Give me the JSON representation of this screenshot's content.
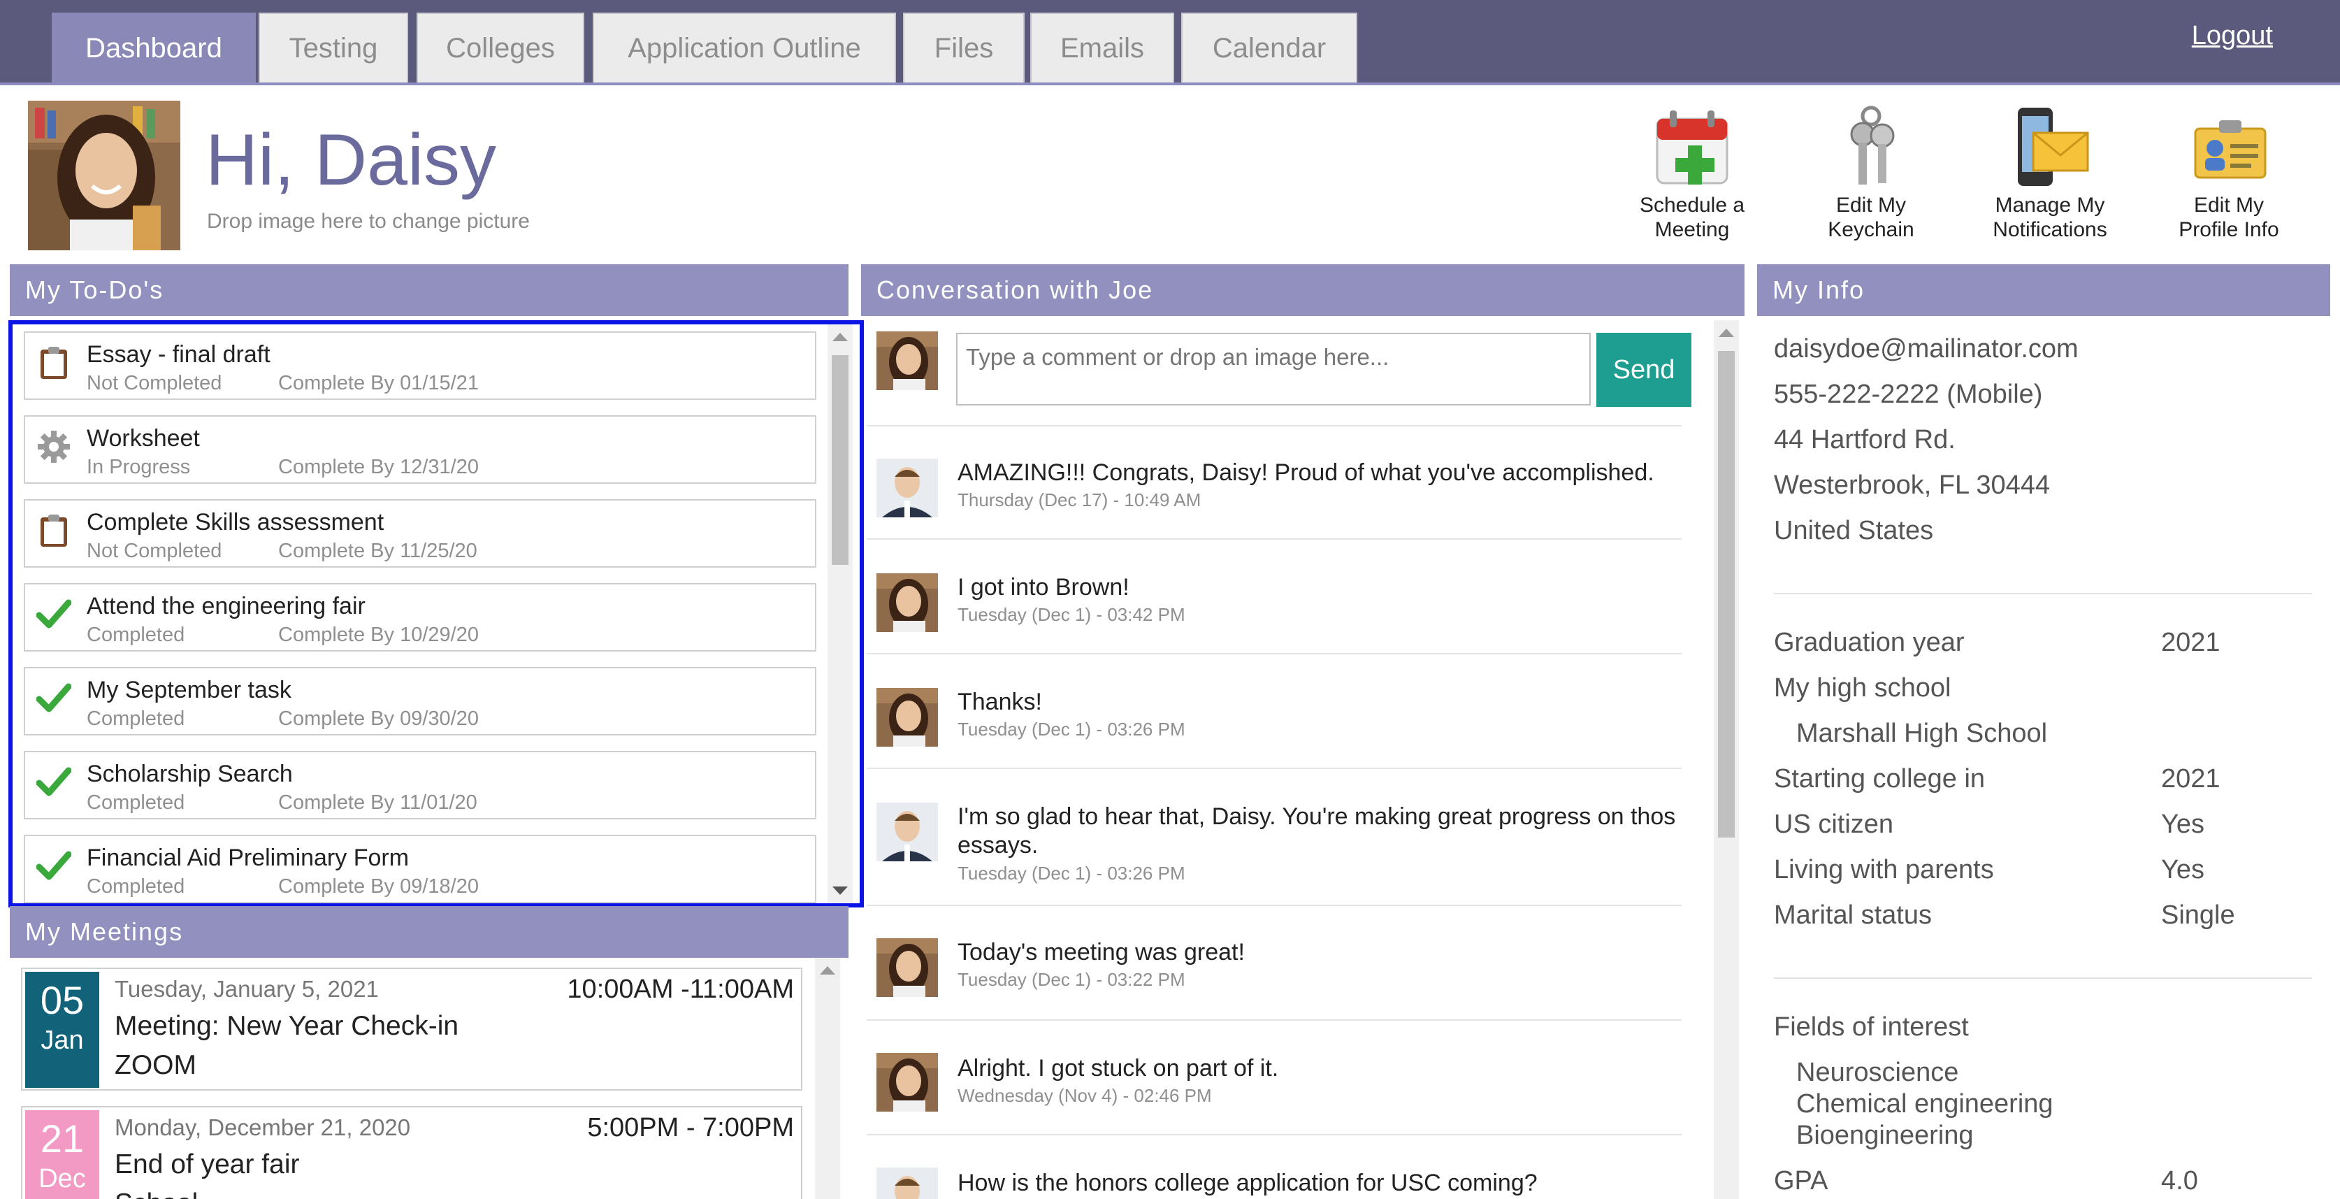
{
  "nav": {
    "tabs": [
      "Dashboard",
      "Testing",
      "Colleges",
      "Application Outline",
      "Files",
      "Emails",
      "Calendar"
    ],
    "logout": "Logout"
  },
  "header": {
    "greeting": "Hi, Daisy",
    "drop_hint": "Drop image here to change picture",
    "actions": [
      {
        "label_line1": "Schedule a",
        "label_line2": "Meeting",
        "icon": "calendar-plus-icon"
      },
      {
        "label_line1": "Edit My",
        "label_line2": "Keychain",
        "icon": "keychain-icon"
      },
      {
        "label_line1": "Manage My",
        "label_line2": "Notifications",
        "icon": "phone-envelope-icon"
      },
      {
        "label_line1": "Edit My",
        "label_line2": "Profile Info",
        "icon": "id-card-icon"
      }
    ]
  },
  "todos": {
    "heading": "My To-Do's",
    "items": [
      {
        "title": "Essay - final draft",
        "status": "Not Completed",
        "due": "Complete By 01/15/21",
        "icon": "clipboard-icon"
      },
      {
        "title": "Worksheet",
        "status": "In Progress",
        "due": "Complete By 12/31/20",
        "icon": "gear-icon"
      },
      {
        "title": "Complete Skills assessment",
        "status": "Not Completed",
        "due": "Complete By 11/25/20",
        "icon": "clipboard-icon"
      },
      {
        "title": "Attend the engineering fair",
        "status": "Completed",
        "due": "Complete By 10/29/20",
        "icon": "checkmark-icon"
      },
      {
        "title": "My September task",
        "status": "Completed",
        "due": "Complete By 09/30/20",
        "icon": "checkmark-icon"
      },
      {
        "title": "Scholarship Search",
        "status": "Completed",
        "due": "Complete By 11/01/20",
        "icon": "checkmark-icon"
      },
      {
        "title": "Financial Aid Preliminary Form",
        "status": "Completed",
        "due": "Complete By 09/18/20",
        "icon": "checkmark-icon"
      }
    ]
  },
  "meetings": {
    "heading": "My Meetings",
    "items": [
      {
        "day": "05",
        "month": "Jan",
        "date": "Tuesday, January 5, 2021",
        "time": "10:00AM -11:00AM",
        "title": "Meeting: New Year Check-in",
        "location": "ZOOM",
        "color": "#12627a"
      },
      {
        "day": "21",
        "month": "Dec",
        "date": "Monday, December 21, 2020",
        "time": "5:00PM - 7:00PM",
        "title": "End of year fair",
        "location": "School",
        "color": "#f29ac4"
      }
    ]
  },
  "conversation": {
    "heading": "Conversation with Joe",
    "placeholder": "Type a comment or drop an image here...",
    "send": "Send",
    "messages": [
      {
        "text": "AMAZING!!! Congrats, Daisy! Proud of what you've accomplished.",
        "time": "Thursday (Dec 17) - 10:49 AM",
        "author": "joe"
      },
      {
        "text": "I got into Brown!",
        "time": "Tuesday (Dec 1) - 03:42 PM",
        "author": "daisy"
      },
      {
        "text": "Thanks!",
        "time": "Tuesday (Dec 1) - 03:26 PM",
        "author": "daisy"
      },
      {
        "text": "I'm so glad to hear that, Daisy. You're making great progress on thos essays.",
        "time": "Tuesday (Dec 1) - 03:26 PM",
        "author": "joe"
      },
      {
        "text": "Today's meeting was great!",
        "time": "Tuesday (Dec 1) - 03:22 PM",
        "author": "daisy"
      },
      {
        "text": "Alright. I got stuck on part of it.",
        "time": "Wednesday (Nov 4) - 02:46 PM",
        "author": "daisy"
      },
      {
        "text": "How is the honors college application for USC coming?",
        "time": "",
        "author": "joe"
      }
    ]
  },
  "info": {
    "heading": "My Info",
    "email": "daisydoe@mailinator.com",
    "phone": "555-222-2222 (Mobile)",
    "address1": "44 Hartford Rd.",
    "address2": "Westerbrook, FL 30444",
    "country": "United States",
    "graduation_year_label": "Graduation year",
    "graduation_year": "2021",
    "high_school_label": "My high school",
    "high_school": "Marshall High School",
    "starting_college_label": "Starting college in",
    "starting_college": "2021",
    "us_citizen_label": "US citizen",
    "us_citizen": "Yes",
    "living_label": "Living with parents",
    "living": "Yes",
    "marital_label": "Marital status",
    "marital": "Single",
    "fields_label": "Fields of interest",
    "fields": [
      "Neuroscience",
      "Chemical engineering",
      "Bioengineering"
    ],
    "gpa_label": "GPA",
    "gpa": "4.0"
  },
  "colors": {
    "nav_bg": "#5b5a7c",
    "panel_header": "#9190bf",
    "active_tab": "#8a88b6",
    "send_button": "#1e9d91",
    "selection_border": "#0a14e6"
  }
}
